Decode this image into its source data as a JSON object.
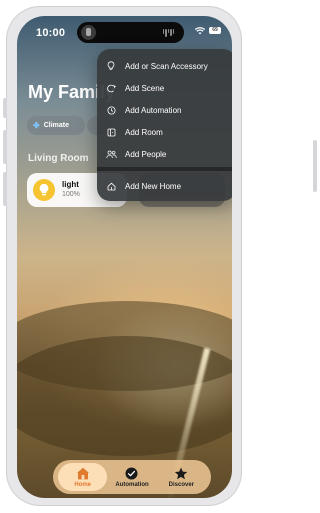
{
  "status_bar": {
    "time": "10:00",
    "battery": "69"
  },
  "home": {
    "title": "My Family",
    "chips": [
      {
        "label": "Climate",
        "icon": "fan-icon"
      }
    ],
    "section_title": "Living Room",
    "accessory": {
      "name": "light",
      "status": "100%"
    }
  },
  "add_menu": {
    "items": [
      {
        "label": "Add or Scan Accessory",
        "icon": "lightbulb-icon"
      },
      {
        "label": "Add Scene",
        "icon": "scene-icon"
      },
      {
        "label": "Add Automation",
        "icon": "clock-icon"
      },
      {
        "label": "Add Room",
        "icon": "room-icon"
      },
      {
        "label": "Add People",
        "icon": "people-icon"
      },
      {
        "label": "Add New Home",
        "icon": "house-icon"
      }
    ]
  },
  "tab_bar": {
    "tabs": [
      {
        "label": "Home",
        "icon": "house-icon",
        "active": true
      },
      {
        "label": "Automation",
        "icon": "clock-icon",
        "active": false
      },
      {
        "label": "Discover",
        "icon": "star-icon",
        "active": false
      }
    ]
  },
  "colors": {
    "accent_orange": "#e07a2e",
    "menu_bg": "#373a3c",
    "bulb_yellow": "#f6c431"
  }
}
